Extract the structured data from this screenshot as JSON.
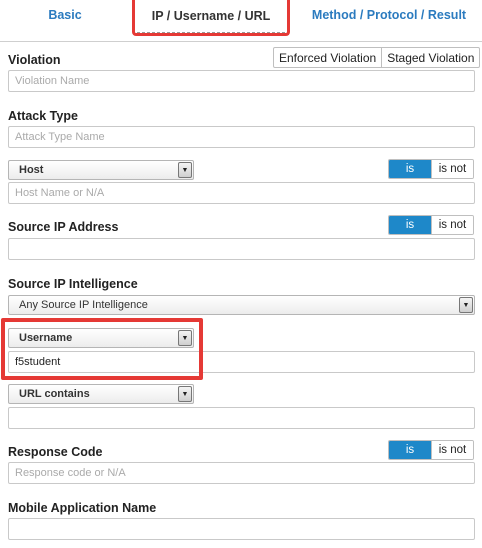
{
  "tabs": {
    "basic": "Basic",
    "ip_username_url": "IP / Username / URL",
    "method_protocol_result": "Method / Protocol / Result"
  },
  "violation": {
    "label": "Violation",
    "placeholder": "Violation Name",
    "enforced": "Enforced Violation",
    "staged": "Staged Violation"
  },
  "attack_type": {
    "label": "Attack Type",
    "placeholder": "Attack Type Name"
  },
  "host": {
    "select": "Host",
    "placeholder": "Host Name or N/A",
    "is": "is",
    "is_not": "is not"
  },
  "source_ip": {
    "label": "Source IP Address",
    "value": "",
    "is": "is",
    "is_not": "is not"
  },
  "source_ip_intel": {
    "label": "Source IP Intelligence",
    "select": "Any Source IP Intelligence"
  },
  "username": {
    "select": "Username",
    "value": "f5student"
  },
  "url": {
    "select": "URL contains",
    "value": ""
  },
  "response_code": {
    "label": "Response Code",
    "placeholder": "Response code or N/A",
    "is": "is",
    "is_not": "is not"
  },
  "mobile_app": {
    "label": "Mobile Application Name",
    "value": ""
  },
  "colors": {
    "accent": "#1e88c9",
    "tab_link": "#2b7bbf",
    "highlight": "#e53935"
  }
}
